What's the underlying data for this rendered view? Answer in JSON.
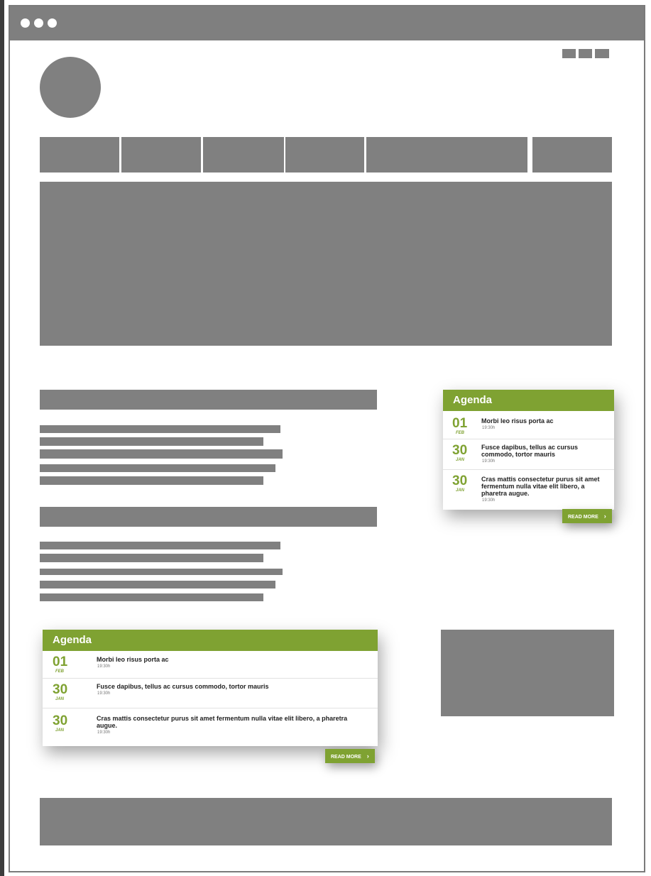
{
  "agenda_sidebar": {
    "title": "Agenda",
    "items": [
      {
        "day": "01",
        "month": "FEB",
        "title": "Morbi leo risus porta ac",
        "time": "19:30h"
      },
      {
        "day": "30",
        "month": "JAN",
        "title": "Fusce dapibus, tellus ac cursus commodo, tortor mauris",
        "time": "19:30h"
      },
      {
        "day": "30",
        "month": "JAN",
        "title": "Cras mattis consectetur purus sit amet fermentum nulla vitae elit libero, a pharetra augue.",
        "time": "19:30h"
      }
    ],
    "read_more": "READ MORE"
  },
  "agenda_main": {
    "title": "Agenda",
    "items": [
      {
        "day": "01",
        "month": "FEB",
        "title": "Morbi leo risus porta ac",
        "time": "19:30h"
      },
      {
        "day": "30",
        "month": "JAN",
        "title": "Fusce dapibus, tellus ac cursus commodo, tortor mauris",
        "time": "19:30h"
      },
      {
        "day": "30",
        "month": "JAN",
        "title": "Cras mattis consectetur purus sit amet fermentum nulla vitae elit libero, a pharetra augue.",
        "time": "19:30h"
      }
    ],
    "read_more": "READ MORE"
  },
  "colors": {
    "accent": "#7fa232",
    "placeholder": "#808080",
    "titlebar": "#7f7f7f"
  }
}
